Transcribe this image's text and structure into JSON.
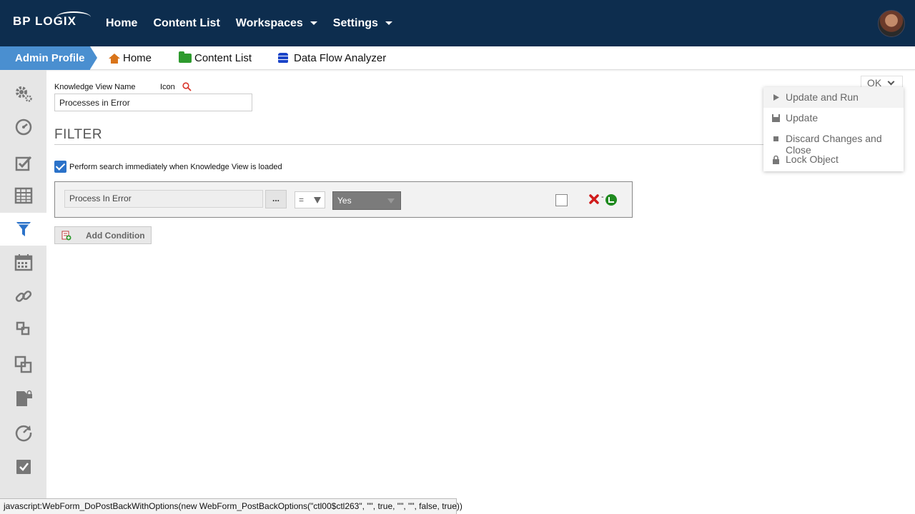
{
  "header": {
    "logo_text_left": "BP",
    "logo_text_right": "LOGIX",
    "nav": [
      {
        "label": "Home"
      },
      {
        "label": "Content List"
      },
      {
        "label": "Workspaces"
      },
      {
        "label": "Settings"
      }
    ]
  },
  "breadcrumb": {
    "current": "Admin Profile",
    "items": [
      {
        "label": "Home"
      },
      {
        "label": "Content List"
      },
      {
        "label": "Data Flow Analyzer"
      }
    ]
  },
  "form": {
    "kv_name_label": "Knowledge View Name",
    "icon_label": "Icon",
    "kv_name_value": "Processes in Error",
    "filter_title": "FILTER",
    "search_checkbox_label": "Perform search immediately when Knowledge View is loaded",
    "search_checkbox_checked": true,
    "condition": {
      "field": "Process In Error",
      "browse_label": "...",
      "operator": "=",
      "value": "Yes",
      "checked": false,
      "dash": "-"
    },
    "add_condition_label": "Add Condition"
  },
  "ok_menu": {
    "button_label": "OK",
    "items": [
      {
        "label": "Update and Run",
        "icon": "play-icon"
      },
      {
        "label": "Update",
        "icon": "save-icon"
      },
      {
        "label": "Discard Changes and Close",
        "icon": "stop-icon"
      },
      {
        "label": "Lock Object",
        "icon": "lock-icon"
      }
    ]
  },
  "status_bar": "javascript:WebForm_DoPostBackWithOptions(new WebForm_PostBackOptions(\"ctl00$ctl263\", \"\", true, \"\", \"\", false, true))",
  "colors": {
    "header_bg": "#0d2d4e",
    "breadcrumb_active": "#4a8fd0",
    "sidebar_bg": "#e6e6e6",
    "sidebar_icon": "#777777",
    "filter_icon_active": "#2b72c9",
    "checkbox_blue": "#2b72c9"
  }
}
